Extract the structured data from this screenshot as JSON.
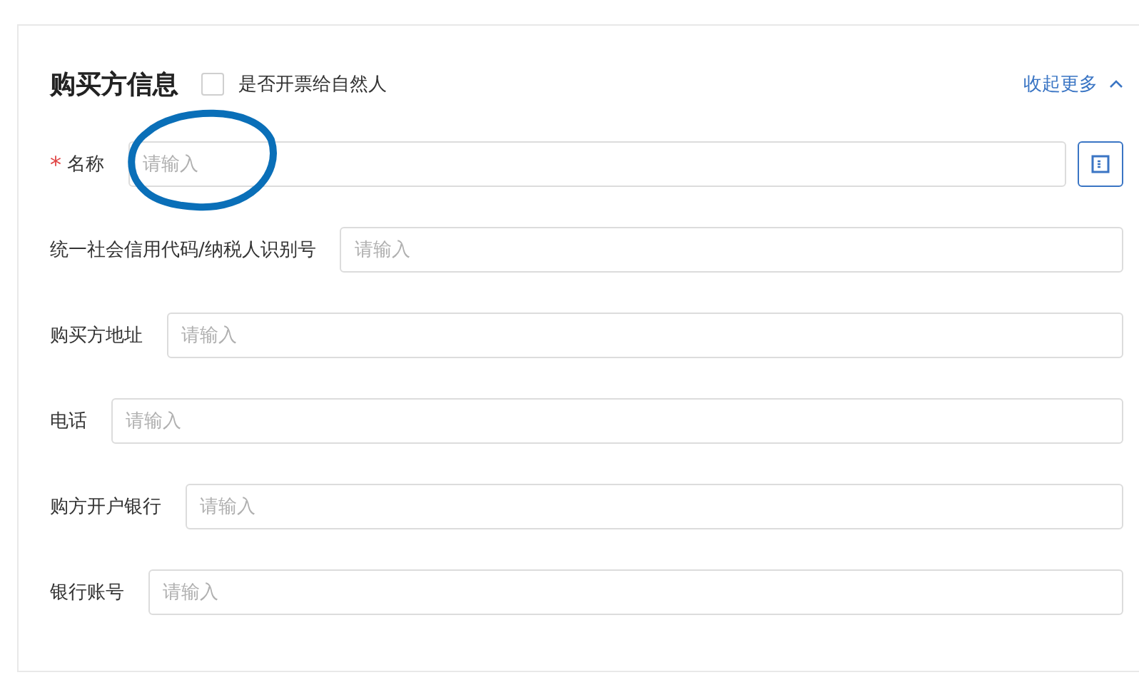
{
  "section": {
    "title": "购买方信息",
    "natural_person": {
      "label": "是否开票给自然人",
      "checked": false
    },
    "collapse_link": "收起更多"
  },
  "required_mark": "*",
  "fields": [
    {
      "label": "名称",
      "required": true,
      "placeholder": "请输入",
      "kind": "lookup"
    },
    {
      "label": "统一社会信用代码/纳税人识别号",
      "required": false,
      "placeholder": "请输入",
      "kind": "plain"
    },
    {
      "label": "购买方地址",
      "required": false,
      "placeholder": "请输入",
      "kind": "plain"
    },
    {
      "label": "电话",
      "required": false,
      "placeholder": "请输入",
      "kind": "plain"
    },
    {
      "label": "购方开户银行",
      "required": false,
      "placeholder": "请输入",
      "kind": "plain"
    },
    {
      "label": "银行账号",
      "required": false,
      "placeholder": "请输入",
      "kind": "plain"
    }
  ]
}
